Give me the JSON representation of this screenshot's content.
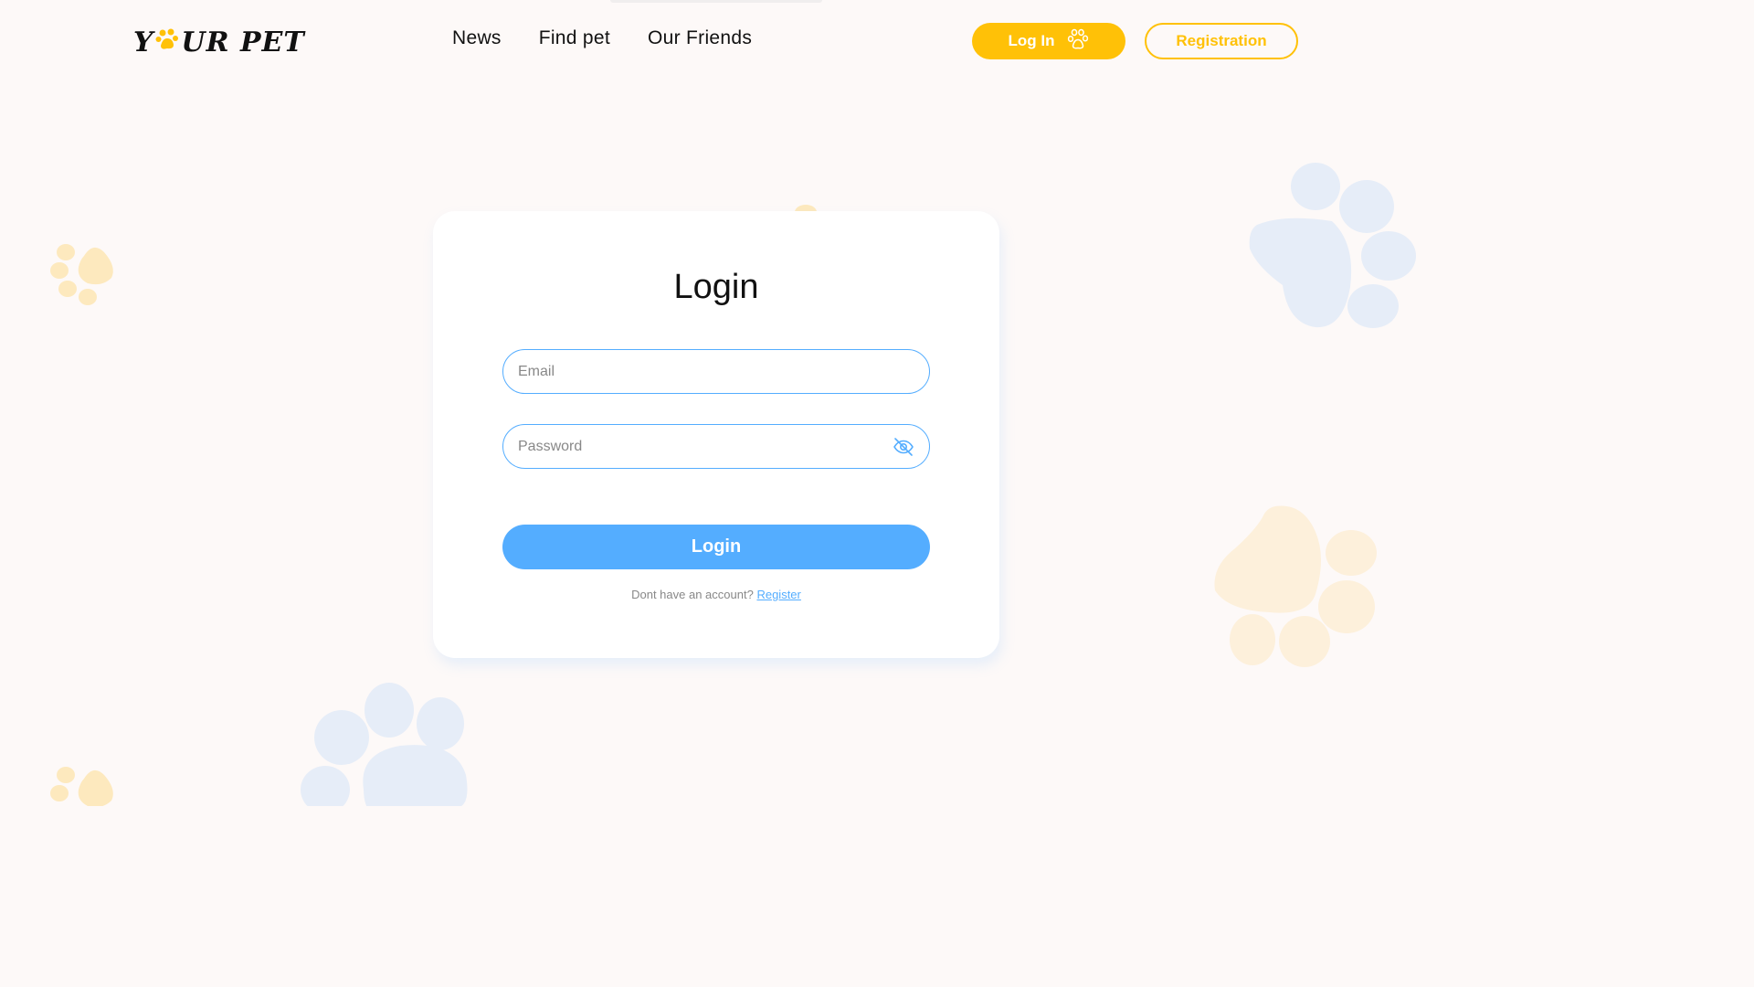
{
  "header": {
    "logo_text_1": "Y",
    "logo_text_2": "UR PET",
    "nav": [
      "News",
      "Find pet",
      "Our Friends"
    ],
    "login_label": "Log In",
    "register_label": "Registration"
  },
  "form": {
    "title": "Login",
    "email_placeholder": "Email",
    "password_placeholder": "Password",
    "submit_label": "Login",
    "hint_text": "Dont have an account?",
    "register_link": "Register"
  },
  "colors": {
    "accent_yellow": "#ffc107",
    "accent_blue": "#54adff",
    "background": "#fdf9f8"
  },
  "icons": {
    "login": "paw-icon",
    "password_toggle": "eye-off-icon",
    "decorations": "paw-print-icon"
  }
}
